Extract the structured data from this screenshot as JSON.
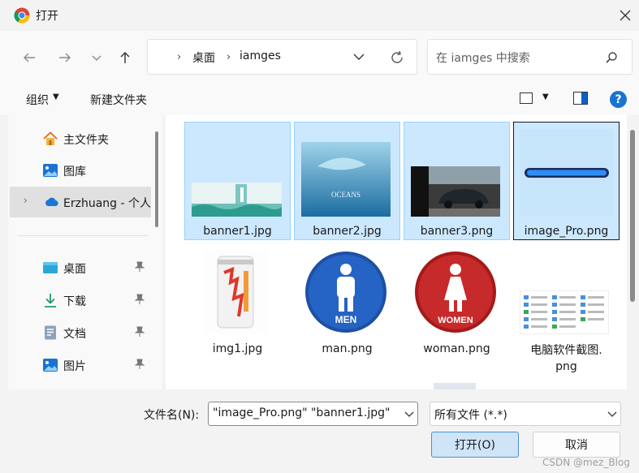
{
  "window": {
    "title": "打开"
  },
  "address": {
    "crumbs": [
      "桌面",
      "iamges"
    ]
  },
  "search": {
    "placeholder": "在 iamges 中搜索"
  },
  "toolbar": {
    "organize": "组织",
    "new_folder": "新建文件夹"
  },
  "nav": {
    "items": [
      {
        "label": "主文件夹"
      },
      {
        "label": "图库"
      },
      {
        "label": "Erzhuang - 个人"
      },
      {
        "label": "桌面"
      },
      {
        "label": "下载"
      },
      {
        "label": "文档"
      },
      {
        "label": "图片"
      }
    ]
  },
  "files": [
    {
      "name": "banner1.jpg"
    },
    {
      "name": "banner2.jpg"
    },
    {
      "name": "banner3.png"
    },
    {
      "name": "image_Pro.png"
    },
    {
      "name": "img1.jpg"
    },
    {
      "name": "man.png"
    },
    {
      "name": "woman.png"
    },
    {
      "name_line1": "电脑软件截图.",
      "name_line2": "png"
    }
  ],
  "thumb_text": {
    "banner2": "OCEANS",
    "man": "MEN",
    "woman": "WOMEN"
  },
  "bottom": {
    "filename_label": "文件名(N):",
    "filename_value": "\"image_Pro.png\" \"banner1.jpg\"",
    "filetype_value": "所有文件 (*.*)",
    "open_label": "打开(O)",
    "cancel_label": "取消"
  },
  "watermark": "CSDN @mez_Blog",
  "colors": {
    "selection": "#cce8ff",
    "accent": "#1a73d0"
  }
}
